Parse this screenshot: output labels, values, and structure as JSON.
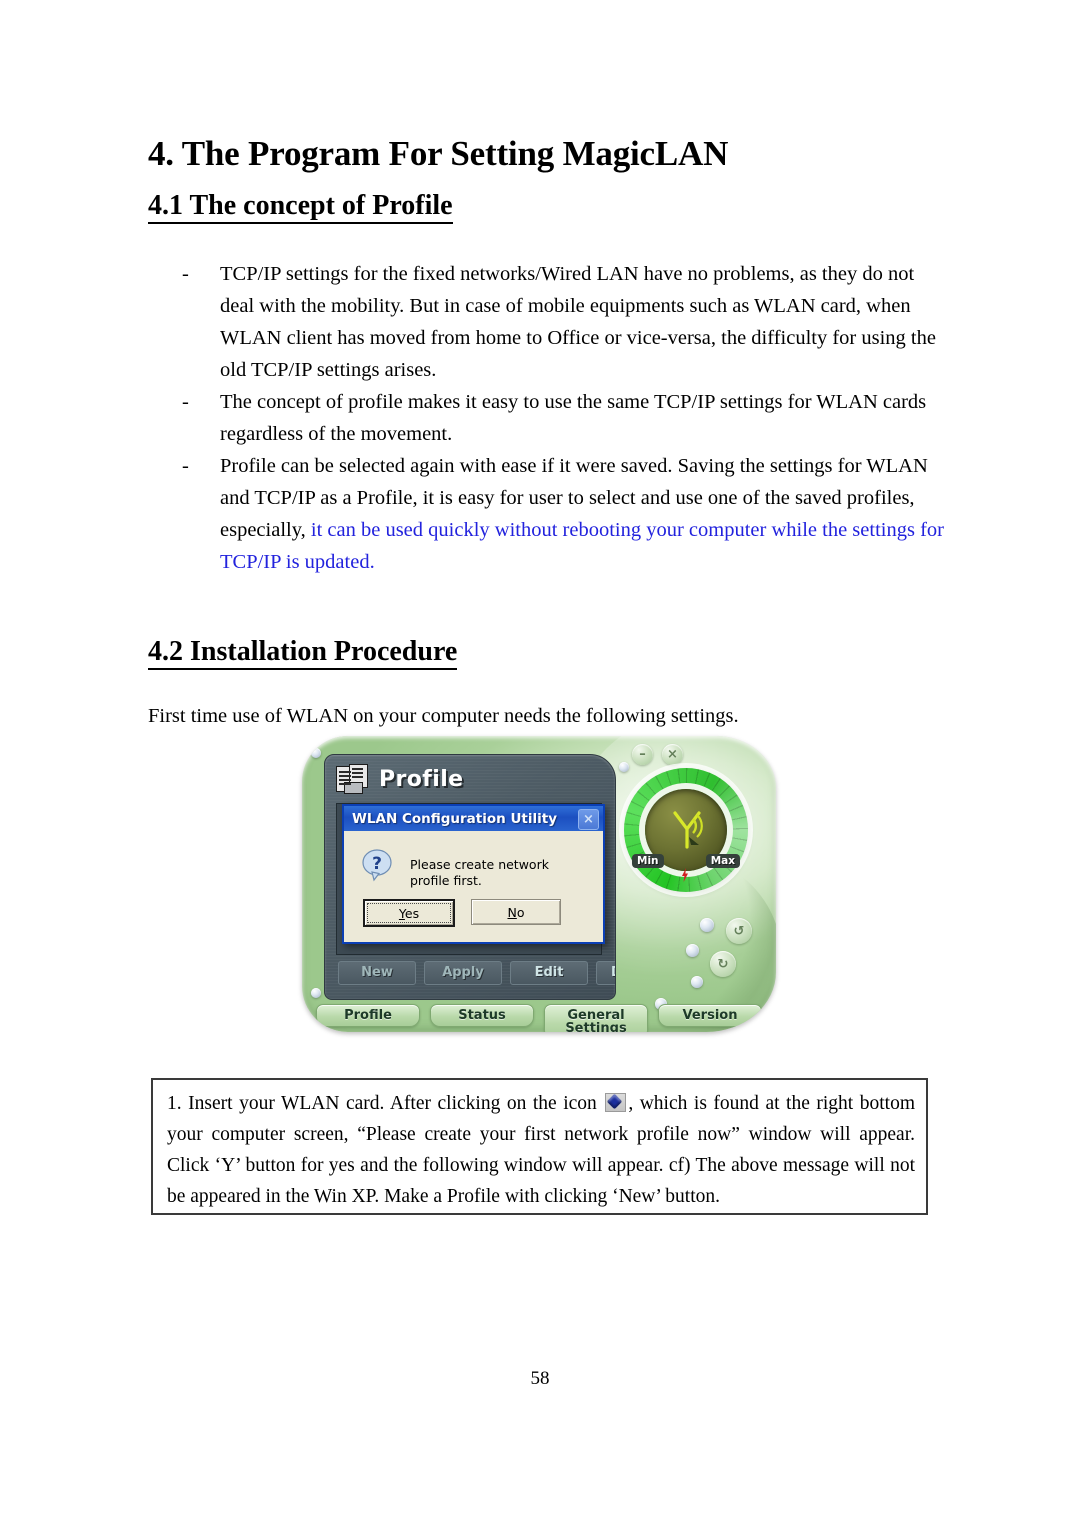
{
  "document": {
    "page_number": "58",
    "h1": "4. The Program For Setting MagicLAN",
    "section_41_heading": "4.1 The concept of Profile",
    "section_42_heading": "4.2 Installation Procedure",
    "bullet_marker": "-",
    "bullets": [
      "TCP/IP settings for the fixed networks/Wired LAN have no problems, as they do not deal with the mobility. But in case of mobile equipments such as WLAN card, when WLAN client has moved from home to Office or vice-versa, the difficulty for using the old TCP/IP settings arises.",
      "The concept of profile makes it easy to use the same TCP/IP settings for WLAN cards regardless of the movement."
    ],
    "bullet3_black": "Profile can be selected again with ease if it were saved. Saving the settings for WLAN and TCP/IP as a Profile, it is easy for user to select and use one of the saved profiles, especially, ",
    "bullet3_blue": "it can be used quickly without rebooting your computer while the settings for TCP/IP is updated.",
    "intro_line": "First time use of WLAN on your computer needs the following settings.",
    "caption": {
      "part1": "1. Insert your WLAN card. After clicking on the icon ",
      "part2": ", which is found at the right bottom your computer screen, “Please create your first network profile now” window will appear. Click ‘Y’ button for yes and the following window will appear. cf) The above message will not be appeared  in the Win XP. Make a Profile with clicking  ‘New’ button."
    },
    "colors": {
      "blue_text": "#2222dd",
      "body_text": "#000000",
      "caption_border": "#3a3a3a"
    }
  },
  "app_screenshot": {
    "panel_title": "Profile",
    "window_buttons": [
      {
        "name": "minimize",
        "glyph": "–"
      },
      {
        "name": "close",
        "glyph": "×"
      }
    ],
    "signal_meter": {
      "min_label": "Min",
      "max_label": "Max"
    },
    "action_buttons": [
      {
        "label": "New",
        "state": "dim"
      },
      {
        "label": "Apply",
        "state": "dim"
      },
      {
        "label": "Edit",
        "state": "bright"
      },
      {
        "label": "Delete",
        "state": "bright"
      }
    ],
    "tabs": [
      {
        "label": "Profile",
        "line2": ""
      },
      {
        "label": "Status",
        "line2": ""
      },
      {
        "label": "General",
        "line2": "Settings"
      },
      {
        "label": "Version",
        "line2": ""
      }
    ],
    "dialog": {
      "title": "WLAN Configuration Utility",
      "close_glyph": "×",
      "message": "Please create network profile first.",
      "buttons": [
        {
          "label_pre": "",
          "accel": "Y",
          "label_post": "es",
          "default": true
        },
        {
          "label_pre": "",
          "accel": "N",
          "label_post": "o",
          "default": false
        }
      ]
    },
    "colors": {
      "skin_green": "#b3d6a4",
      "panel_slate": "#4d5b64",
      "dialog_title_blue": "#1c4fc0",
      "dialog_face": "#ece9d8",
      "ring_green": "#23c423"
    }
  }
}
